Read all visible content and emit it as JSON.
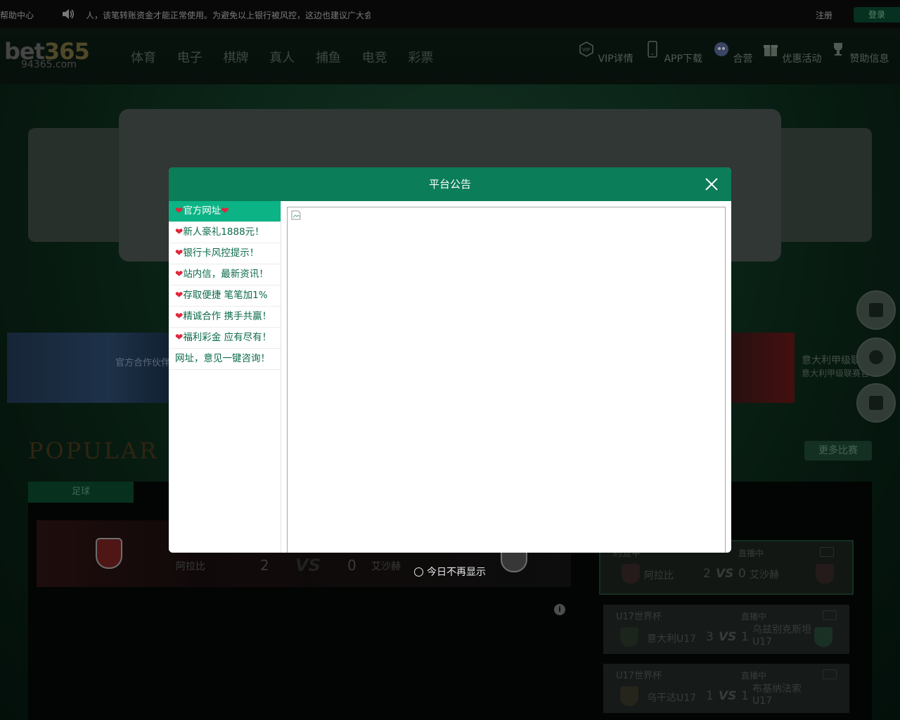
{
  "topbar": {
    "help": "帮助中心",
    "marquee": "人，该笔转账资金才能正常使用。为避免以上银行被风控，这边也建议广大会",
    "register": "注册",
    "login": "登录"
  },
  "header": {
    "logo_main": "bet",
    "logo_num": "365",
    "logo_domain": "94365.com",
    "nav": [
      "体育",
      "电子",
      "棋牌",
      "真人",
      "捕鱼",
      "电竞",
      "彩票"
    ],
    "right_items": [
      {
        "label": "VIP详情",
        "icon": "vip-icon"
      },
      {
        "label": "APP下载",
        "icon": "phone-icon"
      },
      {
        "label": "合营",
        "icon": "partner-icon"
      },
      {
        "label": "优惠活动",
        "icon": "gift-icon"
      },
      {
        "label": "赞助信息",
        "icon": "trophy-icon"
      }
    ]
  },
  "promo": {
    "left_text": "官方合作伙伴",
    "right_title": "意大利甲级联",
    "right_sub": "意大利甲级联赛官"
  },
  "popular": {
    "title": "POPULAR LI",
    "more": "更多比赛",
    "tab": "足球"
  },
  "main_match": {
    "team1": "阿拉比",
    "score1": "2",
    "vs": "VS",
    "score2": "0",
    "team2": "艾沙赫"
  },
  "side_matches": [
    {
      "league": "约旦甲",
      "live": "直播中",
      "team1": "阿拉比",
      "score1": "2",
      "vs": "VS",
      "score2": "0",
      "team2": "艾沙赫"
    },
    {
      "league": "U17世界杯",
      "live": "直播中",
      "team1": "意大利U17",
      "score1": "3",
      "vs": "VS",
      "score2": "1",
      "team2": "乌兹别克斯坦U17"
    },
    {
      "league": "U17世界杯",
      "live": "直播中",
      "team1": "乌干达U17",
      "score1": "1",
      "vs": "VS",
      "score2": "1",
      "team2": "布基纳法索U17"
    }
  ],
  "modal": {
    "title": "平台公告",
    "items": [
      {
        "heart_l": "❤",
        "text": "官方网址",
        "heart_r": "❤"
      },
      {
        "heart_l": "❤",
        "text": "新人豪礼1888元！",
        "heart_r": ""
      },
      {
        "heart_l": "❤",
        "text": "银行卡风控提示！",
        "heart_r": ""
      },
      {
        "heart_l": "❤",
        "text": "站内信，最新资讯！",
        "heart_r": ""
      },
      {
        "heart_l": "❤",
        "text": "存取便捷 笔笔加1%",
        "heart_r": ""
      },
      {
        "heart_l": "❤",
        "text": "精诚合作 携手共赢！",
        "heart_r": ""
      },
      {
        "heart_l": "❤",
        "text": "福利彩金 应有尽有！",
        "heart_r": ""
      },
      {
        "heart_l": "",
        "text": "网址，意见一键咨询！",
        "heart_r": ""
      }
    ],
    "no_show": "今日不再显示"
  },
  "colors": {
    "modal_header": "#0b7d58",
    "active_item": "#0bb385",
    "heart": "#e0263a"
  }
}
